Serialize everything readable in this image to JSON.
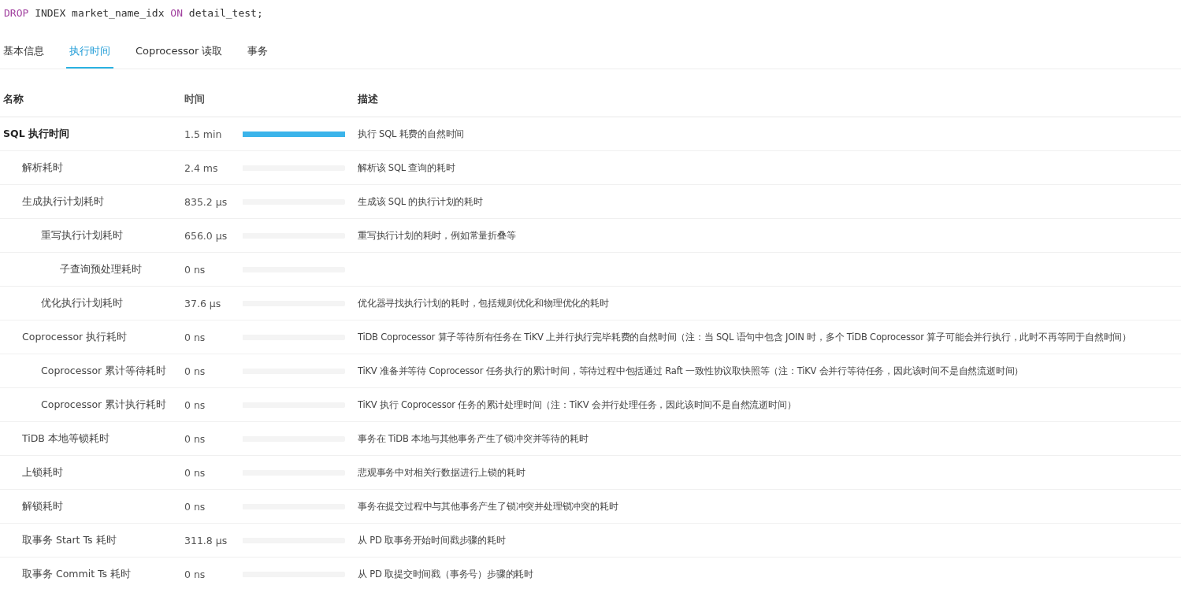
{
  "code": [
    {
      "kind": "keyword",
      "text": "DROP"
    },
    {
      "kind": "plain",
      "text": "INDEX market_name_idx"
    },
    {
      "kind": "keyword",
      "text": "ON"
    },
    {
      "kind": "plain",
      "text": "detail_test;"
    }
  ],
  "tabs": [
    {
      "label": "基本信息",
      "selected": false
    },
    {
      "label": "执行时间",
      "selected": true
    },
    {
      "label": "Coprocessor 读取",
      "selected": false
    },
    {
      "label": "事务",
      "selected": false
    }
  ],
  "table": {
    "columns": [
      "名称",
      "时间",
      "描述"
    ],
    "rows": [
      {
        "name": "SQL 执行时间",
        "bold": true,
        "time": "1.5 min",
        "level": 1,
        "description": "执行 SQL 耗费的自然时间",
        "children": [
          {
            "name": "解析耗时",
            "time": "2.4 ms",
            "level": 0,
            "description": "解析该 SQL 查询的耗时"
          },
          {
            "name": "生成执行计划耗时",
            "time": "835.2 µs",
            "level": 0,
            "description": "生成该 SQL 的执行计划的耗时",
            "children": [
              {
                "name": "重写执行计划耗时",
                "time": "656.0 µs",
                "level": 0,
                "description": "重写执行计划的耗时，例如常量折叠等",
                "children": [
                  {
                    "name": "子查询预处理耗时",
                    "time": "0 ns",
                    "level": 0
                  }
                ]
              },
              {
                "name": "优化执行计划耗时",
                "time": "37.6 µs",
                "level": 0,
                "description": "优化器寻找执行计划的耗时，包括规则优化和物理优化的耗时"
              }
            ]
          },
          {
            "name": "Coprocessor 执行耗时",
            "time": "0 ns",
            "level": 0,
            "description": "TiDB Coprocessor 算子等待所有任务在 TiKV 上并行执行完毕耗费的自然时间（注：当 SQL 语句中包含 JOIN 时，多个 TiDB Coprocessor 算子可能会并行执行，此时不再等同于自然时间）",
            "children": [
              {
                "name": "Coprocessor 累计等待耗时",
                "time": "0 ns",
                "level": 0,
                "description": "TiKV 准备并等待 Coprocessor 任务执行的累计时间，等待过程中包括通过 Raft 一致性协议取快照等（注：TiKV 会并行等待任务，因此该时间不是自然流逝时间）"
              },
              {
                "name": "Coprocessor 累计执行耗时",
                "time": "0 ns",
                "level": 0,
                "description": "TiKV 执行 Coprocessor 任务的累计处理时间（注：TiKV 会并行处理任务，因此该时间不是自然流逝时间）"
              }
            ]
          },
          {
            "name": "TiDB 本地等锁耗时",
            "time": "0 ns",
            "level": 0,
            "description": "事务在 TiDB 本地与其他事务产生了锁冲突并等待的耗时"
          },
          {
            "name": "上锁耗时",
            "time": "0 ns",
            "level": 0,
            "description": "悲观事务中对相关行数据进行上锁的耗时"
          },
          {
            "name": "解锁耗时",
            "time": "0 ns",
            "level": 0,
            "description": "事务在提交过程中与其他事务产生了锁冲突并处理锁冲突的耗时"
          },
          {
            "name": "取事务 Start Ts 耗时",
            "time": "311.8 µs",
            "level": 0,
            "description": "从 PD 取事务开始时间戳步骤的耗时"
          },
          {
            "name": "取事务 Commit Ts 耗时",
            "time": "0 ns",
            "level": 0,
            "description": "从 PD 取提交时间戳（事务号）步骤的耗时"
          }
        ]
      }
    ]
  }
}
